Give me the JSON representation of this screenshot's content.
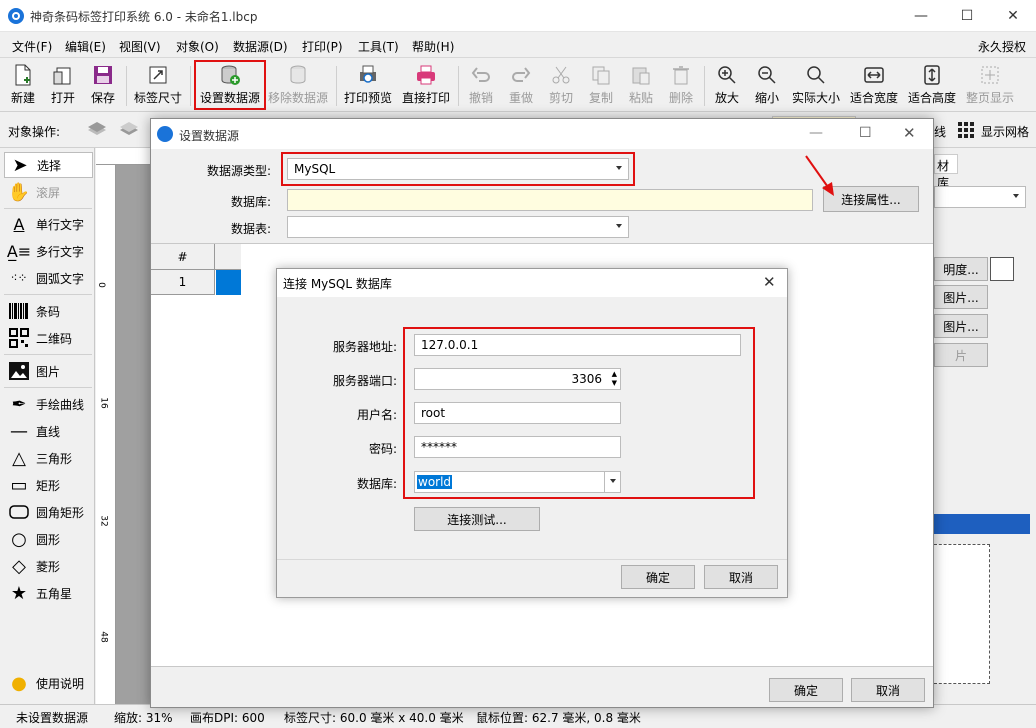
{
  "window": {
    "title": "神奇条码标签打印系统 6.0 - 未命名1.lbcp",
    "min": "—",
    "max": "☐",
    "close": "✕"
  },
  "menu": [
    "文件(F)",
    "编辑(E)",
    "视图(V)",
    "对象(O)",
    "数据源(D)",
    "打印(P)",
    "工具(T)",
    "帮助(H)"
  ],
  "license": "永久授权",
  "toolbar": {
    "new": "新建",
    "open": "打开",
    "save": "保存",
    "label_size": "标签尺寸",
    "set_ds": "设置数据源",
    "remove_ds": "移除数据源",
    "print_preview": "打印预览",
    "direct_print": "直接打印",
    "undo": "撤销",
    "redo": "重做",
    "cut": "剪切",
    "copy": "复制",
    "paste": "粘贴",
    "delete": "删除",
    "zoom_in": "放大",
    "zoom_out": "缩小",
    "actual_size": "实际大小",
    "fit_width": "适合宽度",
    "fit_height": "适合高度",
    "fit_page": "整页显示"
  },
  "objbar": {
    "label": "对象操作:",
    "line_suffix": "线",
    "show_grid": "显示网格"
  },
  "tools": {
    "select": "选择",
    "scroll": "滚屏",
    "single_text": "单行文字",
    "multi_text": "多行文字",
    "arc_text": "圆弧文字",
    "barcode": "条码",
    "qrcode": "二维码",
    "image": "图片",
    "freehand": "手绘曲线",
    "line": "直线",
    "triangle": "三角形",
    "rect": "矩形",
    "round_rect": "圆角矩形",
    "circle": "圆形",
    "diamond": "菱形",
    "star": "五角星",
    "help": "使用说明"
  },
  "ruler_marks": [
    "0",
    "16",
    "32",
    "48"
  ],
  "right_panel": {
    "tab": "材库",
    "btn1": "明度...",
    "btn2": "图片...",
    "btn3": "图片...",
    "btn4": "片"
  },
  "status": {
    "datasource": "未设置数据源",
    "zoom": "缩放: 31%",
    "dpi": "画布DPI: 600",
    "size": "标签尺寸: 60.0 毫米 x 40.0 毫米",
    "pos": "鼠标位置: 62.7 毫米, 0.8 毫米"
  },
  "dialog_ds": {
    "title": "设置数据源",
    "type_label": "数据源类型:",
    "type_value": "MySQL",
    "db_label": "数据库:",
    "db_value": "",
    "table_label": "数据表:",
    "table_value": "",
    "conn_props": "连接属性...",
    "grid_header": "#",
    "grid_row": "1",
    "ok": "确定",
    "cancel": "取消"
  },
  "dialog_mysql": {
    "title": "连接 MySQL 数据库",
    "server_label": "服务器地址:",
    "server_value": "127.0.0.1",
    "port_label": "服务器端口:",
    "port_value": "3306",
    "user_label": "用户名:",
    "user_value": "root",
    "pass_label": "密码:",
    "pass_value": "******",
    "db_label": "数据库:",
    "db_value": "world",
    "test": "连接测试...",
    "ok": "确定",
    "cancel": "取消"
  },
  "colors": {
    "highlight_red": "#e01010",
    "accent_blue": "#0078d7",
    "field_yellow": "#fffde0"
  }
}
